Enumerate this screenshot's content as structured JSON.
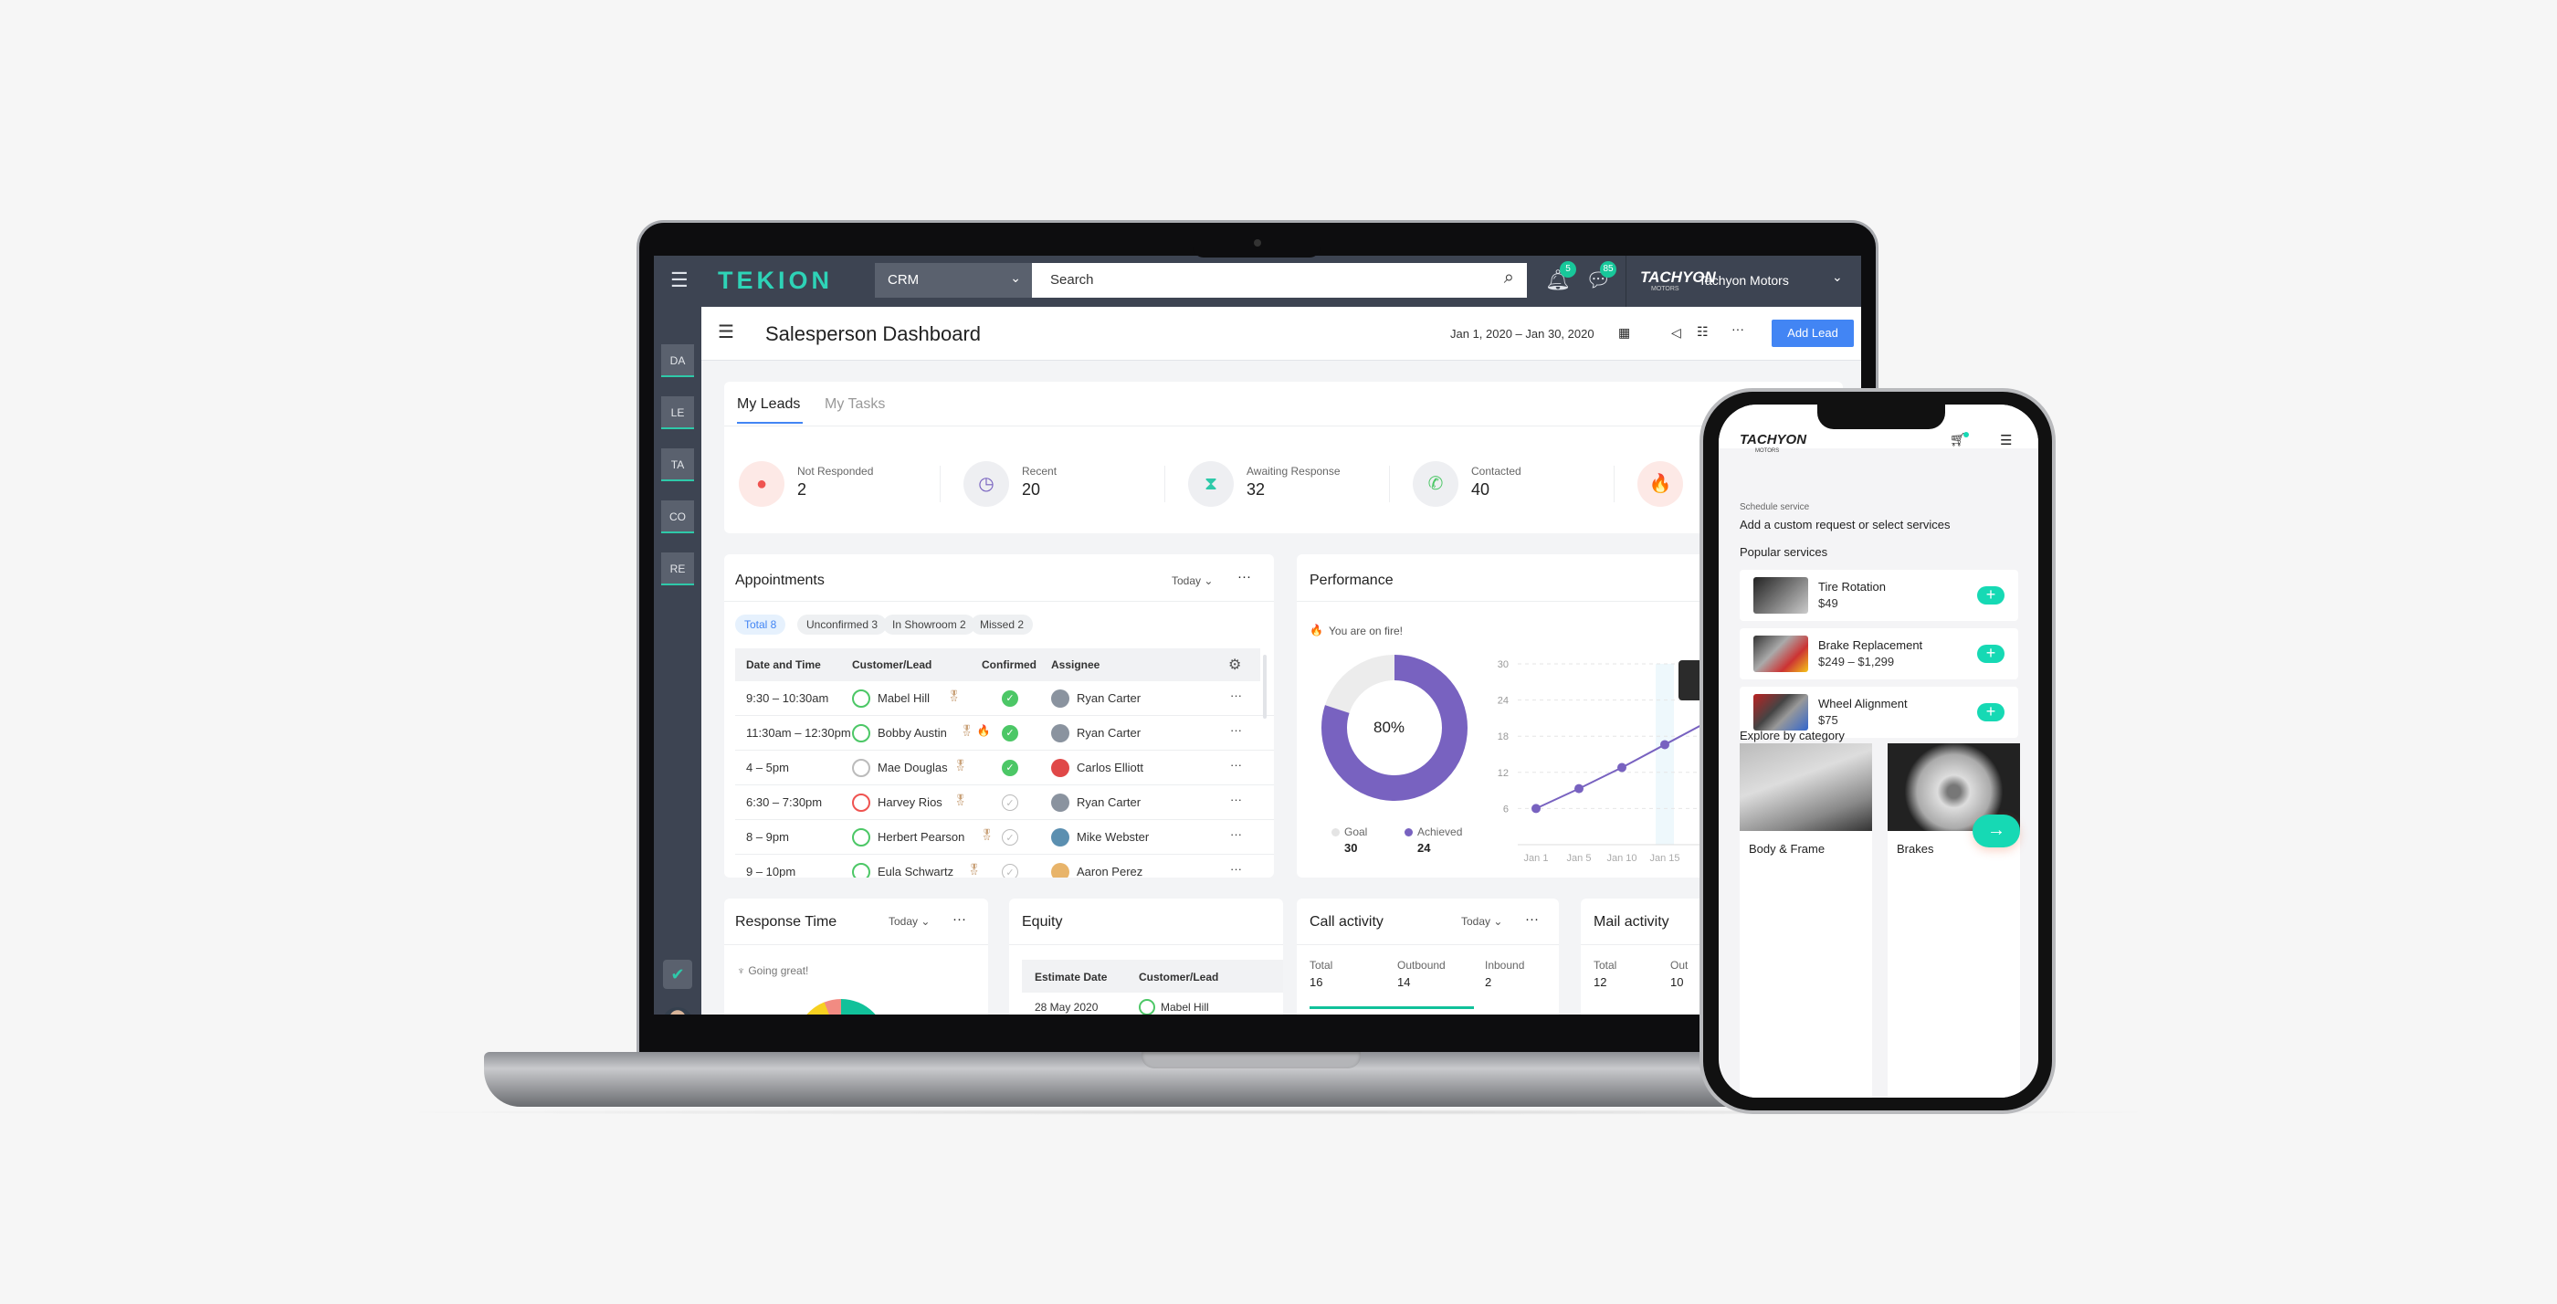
{
  "app": {
    "logo": "TEKION",
    "module": "CRM",
    "search_placeholder": "Search",
    "notifications_count": "5",
    "messages_count": "85",
    "dealer_logo": "TACHYON",
    "dealer_logo_sub": "MOTORS",
    "dealer_name": "Tachyon Motors"
  },
  "sidebar": {
    "items": [
      {
        "label": "DA"
      },
      {
        "label": "LE"
      },
      {
        "label": "TA"
      },
      {
        "label": "CO"
      },
      {
        "label": "RE"
      }
    ]
  },
  "header": {
    "title": "Salesperson Dashboard",
    "date_range": "Jan 1, 2020 – Jan 30, 2020",
    "add_lead": "Add Lead"
  },
  "leads": {
    "tabs": [
      {
        "label": "My Leads",
        "active": true
      },
      {
        "label": "My Tasks",
        "active": false
      }
    ],
    "stats": [
      {
        "label": "Not Responded",
        "value": "2",
        "icon": "alert-icon",
        "color": "#ef5350",
        "bg": "#fde9e6"
      },
      {
        "label": "Recent",
        "value": "20",
        "icon": "clock-icon",
        "color": "#7862c0",
        "bg": "#eeeff2"
      },
      {
        "label": "Awaiting Response",
        "value": "32",
        "icon": "hourglass-icon",
        "color": "#2ec9a9",
        "bg": "#eeeff2"
      },
      {
        "label": "Contacted",
        "value": "40",
        "icon": "phone-icon",
        "color": "#4cc766",
        "bg": "#eeeff2"
      },
      {
        "label": "",
        "value": "",
        "icon": "fire-icon",
        "color": "#f57c1f",
        "bg": "#fde9e6"
      }
    ]
  },
  "appointments": {
    "title": "Appointments",
    "period": "Today",
    "chips": [
      "Total 8",
      "Unconfirmed 3",
      "In Showroom 2",
      "Missed 2"
    ],
    "columns": [
      "Date and Time",
      "Customer/Lead",
      "Confirmed",
      "Assignee"
    ],
    "rows": [
      {
        "time": "9:30 – 10:30am",
        "customer": "Mabel Hill",
        "mood": "happy",
        "confirmed": true,
        "assignee": "Ryan Carter"
      },
      {
        "time": "11:30am – 12:30pm",
        "customer": "Bobby Austin",
        "mood": "happy",
        "confirmed": true,
        "assignee": "Ryan Carter",
        "hot": true
      },
      {
        "time": "4 – 5pm",
        "customer": "Mae Douglas",
        "mood": "neutral",
        "confirmed": true,
        "assignee": "Carlos Elliott"
      },
      {
        "time": "6:30 – 7:30pm",
        "customer": "Harvey Rios",
        "mood": "sad",
        "confirmed": false,
        "assignee": "Ryan Carter"
      },
      {
        "time": "8 – 9pm",
        "customer": "Herbert Pearson",
        "mood": "happy",
        "confirmed": false,
        "assignee": "Mike Webster"
      },
      {
        "time": "9 – 10pm",
        "customer": "Eula Schwartz",
        "mood": "happy",
        "confirmed": false,
        "assignee": "Aaron Perez"
      }
    ]
  },
  "performance": {
    "title": "Performance",
    "message": "You are on fire!",
    "percent_label": "80%",
    "goal_label": "Goal",
    "goal": "30",
    "achieved_label": "Achieved",
    "achieved": "24"
  },
  "chart_data": {
    "type": "line",
    "x": [
      "Jan 1",
      "Jan 5",
      "Jan 10",
      "Jan 15"
    ],
    "series": [
      {
        "values": [
          6,
          9.3,
          12.8,
          16.6
        ]
      }
    ],
    "yticks": [
      6,
      12,
      18,
      24,
      30
    ],
    "ylim": [
      0,
      30
    ],
    "grid": true,
    "highlight": "Jan 15",
    "color": "#7862c0"
  },
  "response_time": {
    "title": "Response Time",
    "period": "Today",
    "message": "Going great!"
  },
  "equity": {
    "title": "Equity",
    "columns": [
      "Estimate Date",
      "Customer/Lead"
    ],
    "rows": [
      {
        "date": "28 May 2020",
        "customer": "Mabel Hill"
      }
    ]
  },
  "call_activity": {
    "title": "Call activity",
    "period": "Today",
    "total_label": "Total",
    "total": "16",
    "outbound_label": "Outbound",
    "outbound": "14",
    "inbound_label": "Inbound",
    "inbound": "2"
  },
  "mail_activity": {
    "title": "Mail activity",
    "total_label": "Total",
    "total": "12",
    "outbound_label": "Out",
    "outbound": "10"
  },
  "phone": {
    "logo": "TACHYON",
    "logo_sub": "MOTORS",
    "eyebrow": "Schedule service",
    "heading": "Add a custom request or select services",
    "popular_title": "Popular services",
    "services": [
      {
        "name": "Tire Rotation",
        "price": "$49"
      },
      {
        "name": "Brake Replacement",
        "price": "$249 – $1,299"
      },
      {
        "name": "Wheel Alignment",
        "price": "$75"
      }
    ],
    "explore_title": "Explore by category",
    "categories": [
      {
        "label": "Body & Frame"
      },
      {
        "label": "Brakes"
      }
    ]
  }
}
